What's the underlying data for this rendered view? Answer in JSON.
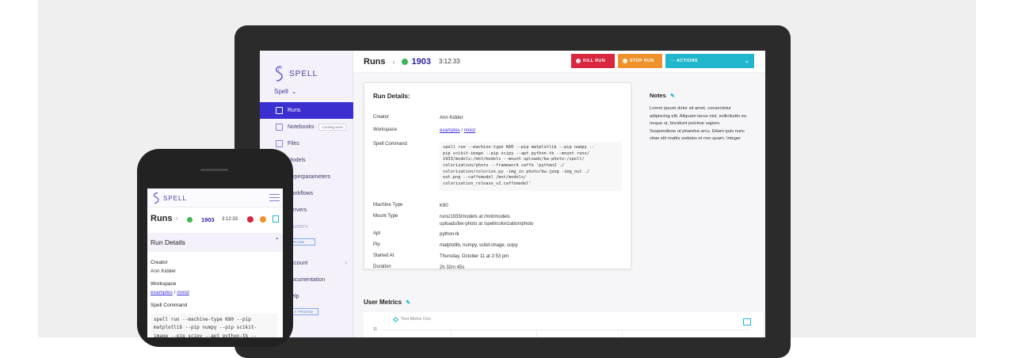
{
  "brand": {
    "name": "SPELL"
  },
  "sidebar": {
    "org": "Spell",
    "items": [
      {
        "label": "Runs",
        "active": true
      },
      {
        "label": "Notebooks",
        "badge": "Coming soon"
      },
      {
        "label": "Files"
      },
      {
        "label": "Models"
      },
      {
        "label": "Hyperparameters"
      },
      {
        "label": "Workflows"
      },
      {
        "label": "Servers"
      },
      {
        "label": "Clusters"
      }
    ],
    "upgrade_button": "UPGRADE",
    "account": "Account",
    "documentation": "Documentation",
    "help": "Help",
    "invite_button": "INVITE A FRIEND"
  },
  "topbar": {
    "title": "Runs",
    "run_number": "1903",
    "duration": "3:12:33",
    "kill_label": "KILL RUN",
    "stop_label": "STOP RUN",
    "actions_label": "··· ACTIONS"
  },
  "run_details": {
    "title": "Run Details:",
    "fields": {
      "creator": {
        "label": "Creator",
        "value": "Ann Kidder"
      },
      "workspace": {
        "label": "Workspace",
        "part1": "examples",
        "sep": "/",
        "part2": "mnist"
      },
      "command": {
        "label": "Spell Command",
        "value": "spell run --machine-type K80 --pip matplotlib --pip numpy --\npip scikit-image --pip scipy --apt python-tk --mount runs/\n1933/models:/mnt/models --mount uploads/bw-photo:/spell/\ncolorization/photo --framework caffe 'python2 ./\ncolorization/colorize.py -img_in photo/bw.jpeg -img_out ./\nout.png --caffemodel /mnt/models/\ncolorization_release_v2.caffemodel'"
      },
      "machine_type": {
        "label": "Machine Type",
        "value": "K80"
      },
      "mount_type": {
        "label": "Mount Type",
        "line1": "runs/1933/models at /mnt/models",
        "line2": "uploads/bw-photo at /spell/colorization/photo"
      },
      "apt": {
        "label": "Apt",
        "value": "python-tk"
      },
      "pip": {
        "label": "Pip",
        "value": "matplotlib, numpy, scikit-image, scipy"
      },
      "started_at": {
        "label": "Started At",
        "value": "Thursday, October 11 at 2:53 pm"
      },
      "duration": {
        "label": "Duration",
        "value": "2h 32m 45s"
      }
    }
  },
  "notes": {
    "title": "Notes",
    "body": "Lorem ipsum dolor sit amet, consectetur adipiscing elit. Aliquam lacus nisl, sollicitudin eu neque ut, tincidunt pulvinar sapien. Suspendisse ut pharetra arcu. Etiam quis nunc vitae elit mattis sodales et non quam. Integer"
  },
  "metrics": {
    "title": "User Metrics",
    "legend": "Test Metric Dos",
    "y_tick": "11"
  },
  "mobile": {
    "brand": "SPELL",
    "title": "Runs",
    "run_number": "1903",
    "duration": "3:12:33",
    "section": "Run Details",
    "creator_label": "Creator",
    "creator_value": "Ann Kidder",
    "workspace_label": "Workspace",
    "workspace_part1": "examples",
    "workspace_sep": "/",
    "workspace_part2": "mnist",
    "command_label": "Spell Command",
    "command_value": "spell run --machine-type K80 --pip\nmatplotlib --pip numpy --pip scikit-\nimage --pip scipy --apt python-tk --"
  },
  "colors": {
    "primary": "#3b2fd1",
    "kill": "#d7263d",
    "stop": "#f0922b",
    "actions": "#20b6cc",
    "status_running": "#3fb45b"
  }
}
